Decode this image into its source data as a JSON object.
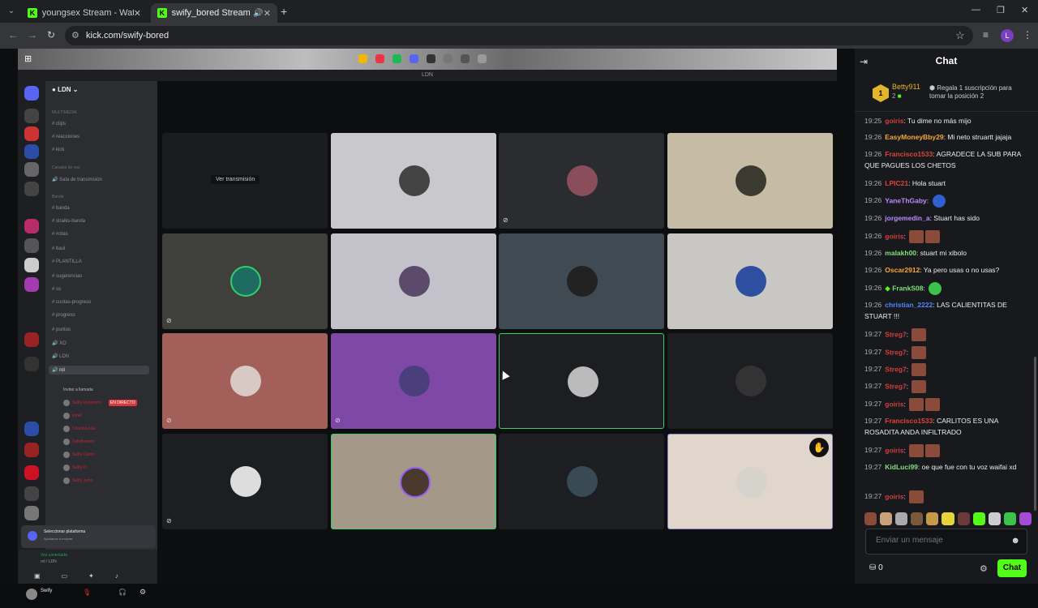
{
  "browser": {
    "tabs": [
      {
        "title": "youngsex Stream - Watch Live o",
        "active": false
      },
      {
        "title": "swify_bored Stream - Watch",
        "active": true
      }
    ],
    "url": "kick.com/swify-bored"
  },
  "discord": {
    "window_title": "LDN",
    "server_name": "LDN",
    "channels": [
      {
        "label": "MULTIMEDIA",
        "kind": "category"
      },
      {
        "label": "clips",
        "kind": "text"
      },
      {
        "label": "reacciones",
        "kind": "text"
      },
      {
        "label": "kick",
        "kind": "text"
      },
      {
        "label": "Canales de voz",
        "kind": "category"
      },
      {
        "label": "Sala de transmisión",
        "kind": "voice"
      },
      {
        "label": "Banda",
        "kind": "category"
      },
      {
        "label": "banda",
        "kind": "text"
      },
      {
        "label": "straiks-banda",
        "kind": "text"
      },
      {
        "label": "notas",
        "kind": "text"
      },
      {
        "label": "baul",
        "kind": "text"
      },
      {
        "label": "PLANTILLA",
        "kind": "text"
      },
      {
        "label": "sugerencias",
        "kind": "text"
      },
      {
        "label": "ss",
        "kind": "text"
      },
      {
        "label": "cuotas-progreso",
        "kind": "text"
      },
      {
        "label": "progreso",
        "kind": "text"
      },
      {
        "label": "puntos",
        "kind": "text"
      },
      {
        "label": "XO",
        "kind": "voice"
      },
      {
        "label": "LDN",
        "kind": "voice"
      },
      {
        "label": "rol",
        "kind": "voice-active"
      }
    ],
    "voice_users": [
      {
        "label": "Invitar a llamada",
        "live": ""
      },
      {
        "label": "Swify Roberticio",
        "live": "EN DIRECTO"
      },
      {
        "label": "kimel",
        "live": ""
      },
      {
        "label": "ChuckyLoSa",
        "live": ""
      },
      {
        "label": "FabyBerenic",
        "live": ""
      },
      {
        "label": "Swify Carlos",
        "live": ""
      },
      {
        "label": "Swify Pi",
        "live": ""
      },
      {
        "label": "Swify Jamo",
        "live": ""
      }
    ],
    "popup_title": "Seleccionar plataforma",
    "popup_sub": "Ayúdanos a mejorar",
    "voice_connected": "Voz conectada",
    "voice_channel": "rol / LDN",
    "username": "Swify",
    "watch_label": "Ver transmisión"
  },
  "chat": {
    "title": "Chat",
    "pinned": {
      "rank": "1",
      "username": "Betty911",
      "count": "2",
      "gift_text": "Regala 1 suscripción para tomar la posición 2"
    },
    "messages": [
      {
        "ts": "19:25",
        "user": "goiris",
        "color": "#d23f3f",
        "text": "Tu dime no más mijo"
      },
      {
        "ts": "19:26",
        "user": "EasyMoneyBby29",
        "color": "#f2a93b",
        "text": "Mi neto struartt jajaja"
      },
      {
        "ts": "19:26",
        "user": "Francisco1533",
        "color": "#e0443a",
        "text": "AGRADECE LA SUB PARA QUE PAGUES LOS CHETOS"
      },
      {
        "ts": "19:26",
        "user": "LPIC21",
        "color": "#e0443a",
        "text": "Hola stuart"
      },
      {
        "ts": "19:26",
        "user": "YaneThGaby",
        "color": "#b98cff",
        "text": ""
      },
      {
        "ts": "19:26",
        "user": "jorgemedin_a",
        "color": "#b98cff",
        "text": "Stuart has sido"
      },
      {
        "ts": "19:26",
        "user": "goiris",
        "color": "#d23f3f",
        "text": ""
      },
      {
        "ts": "19:26",
        "user": "malakh00",
        "color": "#7ee07e",
        "text": "stuart mi xibolo"
      },
      {
        "ts": "19:26",
        "user": "Oscar2912",
        "color": "#f2a93b",
        "text": "Ya pero usas o no usas?"
      },
      {
        "ts": "19:26",
        "user": "FrankS08",
        "color": "#7ee07e",
        "text": ""
      },
      {
        "ts": "19:26",
        "user": "christian_2222",
        "color": "#4a8cff",
        "text": "LAS CALIENTITAS DE STUART !!!"
      },
      {
        "ts": "19:27",
        "user": "Streg7",
        "color": "#d23f3f",
        "text": ""
      },
      {
        "ts": "19:27",
        "user": "Streg7",
        "color": "#d23f3f",
        "text": ""
      },
      {
        "ts": "19:27",
        "user": "Streg7",
        "color": "#d23f3f",
        "text": ""
      },
      {
        "ts": "19:27",
        "user": "Streg7",
        "color": "#d23f3f",
        "text": ""
      },
      {
        "ts": "19:27",
        "user": "goiris",
        "color": "#d23f3f",
        "text": ""
      },
      {
        "ts": "19:27",
        "user": "Francisco1533",
        "color": "#e0443a",
        "text": "CARLITOS ES UNA ROSADITA ANDA INFILTRADO"
      },
      {
        "ts": "19:27",
        "user": "goiris",
        "color": "#d23f3f",
        "text": ""
      },
      {
        "ts": "19:27",
        "user": "KidLuci99",
        "color": "#7ee07e",
        "text": "oe que fue con tu voz waifai xd"
      },
      {
        "ts": "19:27",
        "user": "goiris",
        "color": "#d23f3f",
        "text": ""
      }
    ],
    "input_placeholder": "Enviar un mensaje",
    "points": "0",
    "send_label": "Chat"
  }
}
